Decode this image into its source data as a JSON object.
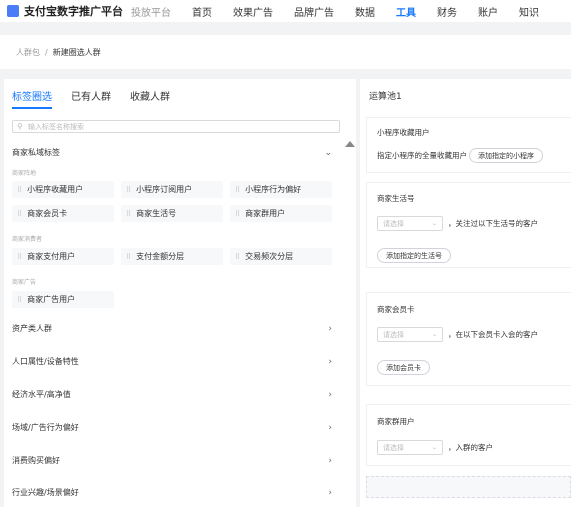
{
  "app": {
    "title": "支付宝数字推广平台",
    "subtitle": "投放平台"
  },
  "nav": [
    "首页",
    "效果广告",
    "品牌广告",
    "数据",
    "工具",
    "财务",
    "账户",
    "知识"
  ],
  "nav_active": "工具",
  "breadcrumb": {
    "parent": "人群包",
    "separator": "/",
    "current": "新建圈选人群"
  },
  "tabs": [
    "标签圈选",
    "已有人群",
    "收藏人群"
  ],
  "search": {
    "placeholder": "输入标签名称搜索"
  },
  "private_section": {
    "title": "商家私域标签",
    "groups": [
      {
        "label": "商家阵地",
        "items": [
          "小程序收藏用户",
          "小程序订阅用户",
          "小程序行为偏好",
          "商家会员卡",
          "商家生活号",
          "商家群用户"
        ]
      },
      {
        "label": "商家消费者",
        "items": [
          "商家支付用户",
          "支付金额分层",
          "交易频次分层"
        ]
      },
      {
        "label": "商家广告",
        "items": [
          "商家广告用户"
        ]
      }
    ]
  },
  "categories": [
    "资产类人群",
    "人口属性/设备特性",
    "经济水平/高净值",
    "场域/广告行为偏好",
    "消费购买偏好",
    "行业兴趣/场景偏好"
  ],
  "pool": {
    "title": "运算池1",
    "cards": [
      {
        "title": "小程序收藏用户",
        "desc": "指定小程序的全量收藏用户",
        "button": "添加指定的小程序"
      },
      {
        "title": "商家生活号",
        "select_placeholder": "请选择",
        "suffix": "，关注过以下生活号的客户",
        "button": "添加指定的生活号"
      },
      {
        "title": "商家会员卡",
        "select_placeholder": "请选择",
        "suffix": "，在以下会员卡入会的客户",
        "button": "添加会员卡"
      },
      {
        "title": "商家群用户",
        "select_placeholder": "请选择",
        "suffix": "，入群的客户"
      }
    ]
  },
  "colors": {
    "accent": "#1677ff",
    "chip_bg": "#f7f8fa",
    "page_bg": "#f2f3f5"
  }
}
